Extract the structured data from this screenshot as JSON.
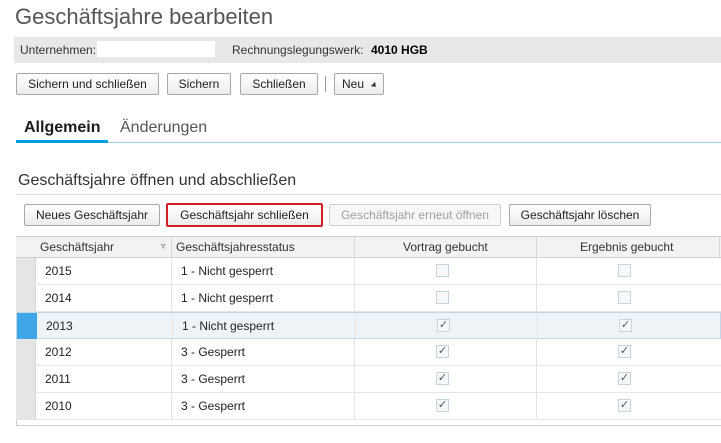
{
  "page": {
    "title": "Geschäftsjahre bearbeiten"
  },
  "info": {
    "company_label": "Unternehmen:",
    "company_value": "",
    "accounting_label": "Rechnungslegungswerk:",
    "accounting_value": "4010 HGB"
  },
  "toolbar": {
    "save_close": "Sichern und schließen",
    "save": "Sichern",
    "close": "Schließen",
    "new": "Neu"
  },
  "tabs": [
    {
      "label": "Allgemein",
      "active": true
    },
    {
      "label": "Änderungen",
      "active": false
    }
  ],
  "section": {
    "title": "Geschäftsjahre öffnen und abschließen",
    "actions": {
      "new_year": "Neues Geschäftsjahr",
      "close_year": "Geschäftsjahr schließen",
      "reopen_year": "Geschäftsjahr erneut öffnen",
      "delete_year": "Geschäftsjahr löschen"
    }
  },
  "table": {
    "columns": [
      "Geschäftsjahr",
      "Geschäftsjahresstatus",
      "Vortrag gebucht",
      "Ergebnis gebucht"
    ],
    "rows": [
      {
        "year": "2015",
        "status": "1 - Nicht gesperrt",
        "vortrag": false,
        "ergebnis": false,
        "selected": false
      },
      {
        "year": "2014",
        "status": "1 - Nicht gesperrt",
        "vortrag": false,
        "ergebnis": false,
        "selected": false
      },
      {
        "year": "2013",
        "status": "1 - Nicht gesperrt",
        "vortrag": true,
        "ergebnis": true,
        "selected": true
      },
      {
        "year": "2012",
        "status": "3 - Gesperrt",
        "vortrag": true,
        "ergebnis": true,
        "selected": false
      },
      {
        "year": "2011",
        "status": "3 - Gesperrt",
        "vortrag": true,
        "ergebnis": true,
        "selected": false
      },
      {
        "year": "2010",
        "status": "3 - Gesperrt",
        "vortrag": true,
        "ergebnis": true,
        "selected": false
      }
    ]
  },
  "icons": {
    "sort": "sort-filter-icon",
    "dropdown": "chevron-down-icon",
    "check": "checkmark-icon"
  },
  "colors": {
    "accent": "#009de0",
    "selection": "#3fa6e8",
    "highlight_border": "#d21f26"
  }
}
